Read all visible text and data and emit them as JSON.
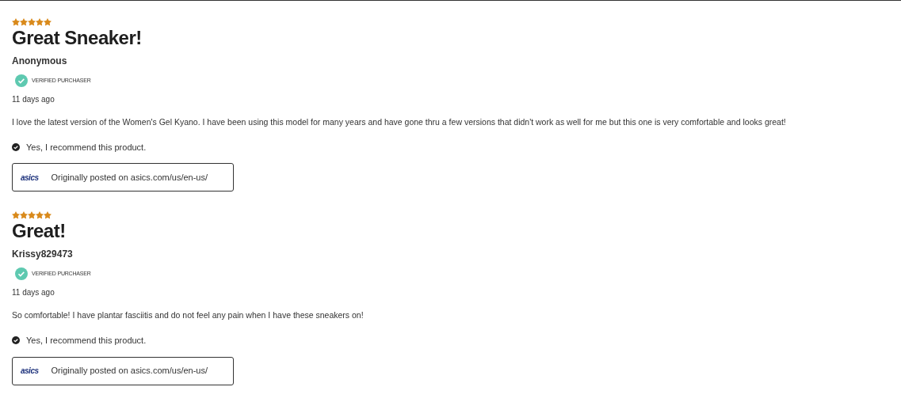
{
  "reviews": [
    {
      "stars": 5,
      "title": "Great Sneaker!",
      "author": "Anonymous",
      "badge": "VERIFIED PURCHASER",
      "date": "11 days ago",
      "body": "I love the latest version of the Women's Gel Kyano. I have been using this model for many years and have gone thru a few versions that didn't work as well for me but this one is very comfortable and looks great!",
      "recommend": "Yes, I recommend this product.",
      "source_logo": "asics",
      "source": "Originally posted on asics.com/us/en-us/"
    },
    {
      "stars": 5,
      "title": "Great!",
      "author": "Krissy829473",
      "badge": "VERIFIED PURCHASER",
      "date": "11 days ago",
      "body": "So comfortable! I have plantar fasciitis and do not feel any pain when I have these sneakers on!",
      "recommend": "Yes, I recommend this product.",
      "source_logo": "asics",
      "source": "Originally posted on asics.com/us/en-us/"
    }
  ]
}
